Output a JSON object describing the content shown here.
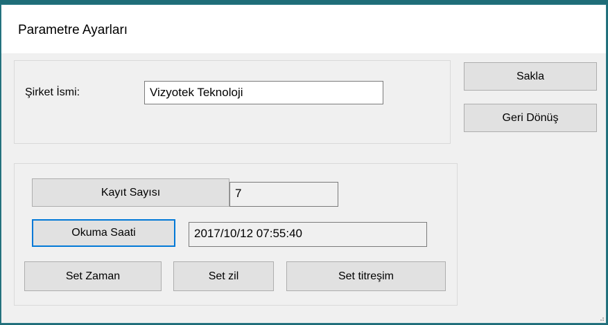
{
  "window": {
    "title": "Parametre Ayarları"
  },
  "company": {
    "label": "Şirket  İsmi:",
    "value": "Vizyotek Teknoloji"
  },
  "side_buttons": {
    "save": "Sakla",
    "back": "Geri Dönüş"
  },
  "record_count": {
    "button": "Kayıt Sayısı",
    "value": "7"
  },
  "read_time": {
    "button": "Okuma Saati",
    "value": "2017/10/12 07:55:40"
  },
  "set_buttons": {
    "time": "Set Zaman",
    "bell": "Set zil",
    "vibration": "Set titreşim"
  },
  "colors": {
    "focus": "#0078d7",
    "desktop": "#1f6d78"
  },
  "icons": [
    "resize-grip-icon"
  ]
}
